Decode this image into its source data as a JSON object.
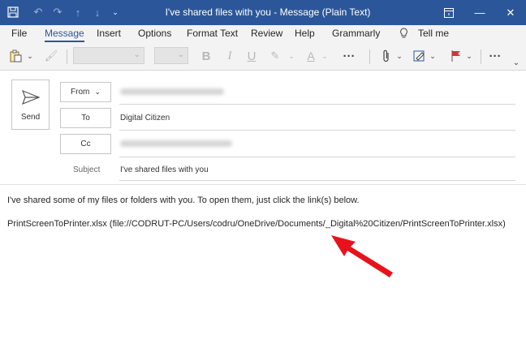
{
  "window": {
    "title": "I've shared files with you  -  Message (Plain Text)",
    "accent": "#2b579a"
  },
  "quick_access": [
    "save-icon",
    "undo-icon",
    "redo-icon",
    "up-arrow-icon",
    "down-arrow-icon",
    "customize-icon"
  ],
  "ribbon": {
    "tabs": [
      "File",
      "Message",
      "Insert",
      "Options",
      "Format Text",
      "Review",
      "Help",
      "Grammarly"
    ],
    "tell_me": "Tell me",
    "active_tab": "Message"
  },
  "toolbar": {
    "bold": "B",
    "italic": "I",
    "underline": "U",
    "more": "···"
  },
  "header": {
    "send_label": "Send",
    "from_label": "From",
    "to_label": "To",
    "to_value": "Digital Citizen",
    "cc_label": "Cc",
    "subject_label": "Subject",
    "subject_value": "I've shared files with you"
  },
  "body": {
    "line1": "I've shared some of my files or folders with you. To open them, just click the link(s) below.",
    "line2": "PrintScreenToPrinter.xlsx (file://CODRUT-PC/Users/codru/OneDrive/Documents/_Digital%20Citizen/PrintScreenToPrinter.xlsx)"
  },
  "annotation_color": "#e8121c"
}
